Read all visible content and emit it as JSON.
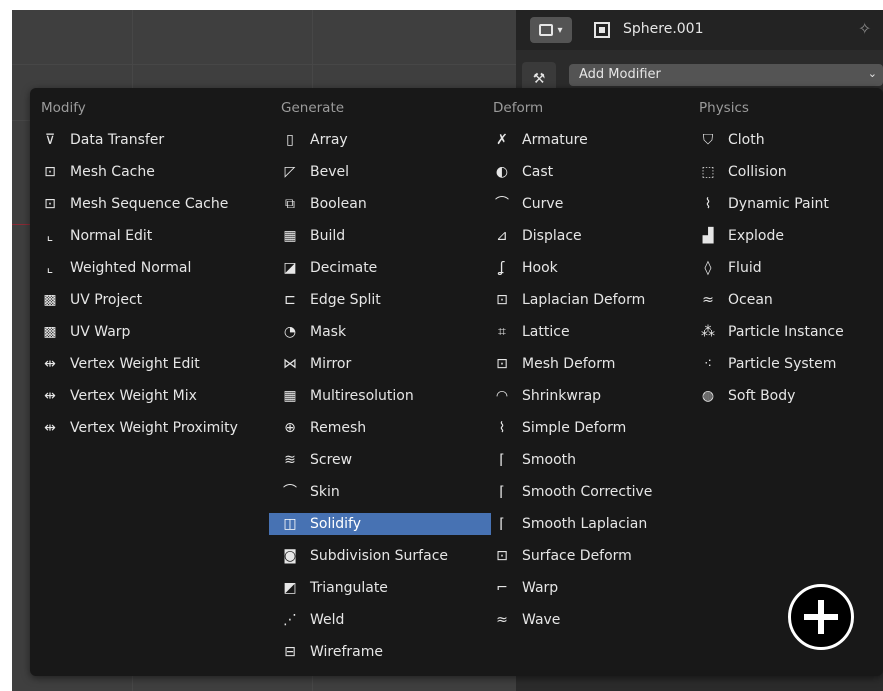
{
  "header": {
    "object_name": "Sphere.001",
    "add_modifier_label": "Add Modifier"
  },
  "menu": {
    "columns": [
      {
        "title": "Modify",
        "items": [
          {
            "label": "Data Transfer",
            "icon": "data-transfer-icon",
            "glyph": "⊽"
          },
          {
            "label": "Mesh Cache",
            "icon": "mesh-cache-icon",
            "glyph": "⊡"
          },
          {
            "label": "Mesh Sequence Cache",
            "icon": "mesh-sequence-cache-icon",
            "glyph": "⊡"
          },
          {
            "label": "Normal Edit",
            "icon": "normal-edit-icon",
            "glyph": "⌞"
          },
          {
            "label": "Weighted Normal",
            "icon": "weighted-normal-icon",
            "glyph": "⌞"
          },
          {
            "label": "UV Project",
            "icon": "uv-project-icon",
            "glyph": "▩"
          },
          {
            "label": "UV Warp",
            "icon": "uv-warp-icon",
            "glyph": "▩"
          },
          {
            "label": "Vertex Weight Edit",
            "icon": "vertex-weight-edit-icon",
            "glyph": "⇹"
          },
          {
            "label": "Vertex Weight Mix",
            "icon": "vertex-weight-mix-icon",
            "glyph": "⇹"
          },
          {
            "label": "Vertex Weight Proximity",
            "icon": "vertex-weight-proximity-icon",
            "glyph": "⇹"
          }
        ]
      },
      {
        "title": "Generate",
        "items": [
          {
            "label": "Array",
            "icon": "array-icon",
            "glyph": "▯"
          },
          {
            "label": "Bevel",
            "icon": "bevel-icon",
            "glyph": "◸"
          },
          {
            "label": "Boolean",
            "icon": "boolean-icon",
            "glyph": "⧉"
          },
          {
            "label": "Build",
            "icon": "build-icon",
            "glyph": "▦"
          },
          {
            "label": "Decimate",
            "icon": "decimate-icon",
            "glyph": "◪"
          },
          {
            "label": "Edge Split",
            "icon": "edge-split-icon",
            "glyph": "⊏"
          },
          {
            "label": "Mask",
            "icon": "mask-icon",
            "glyph": "◔"
          },
          {
            "label": "Mirror",
            "icon": "mirror-icon",
            "glyph": "⋈"
          },
          {
            "label": "Multiresolution",
            "icon": "multiresolution-icon",
            "glyph": "▦"
          },
          {
            "label": "Remesh",
            "icon": "remesh-icon",
            "glyph": "⊕"
          },
          {
            "label": "Screw",
            "icon": "screw-icon",
            "glyph": "≋"
          },
          {
            "label": "Skin",
            "icon": "skin-icon",
            "glyph": "⌒"
          },
          {
            "label": "Solidify",
            "icon": "solidify-icon",
            "glyph": "◫",
            "selected": true
          },
          {
            "label": "Subdivision Surface",
            "icon": "subdivision-surface-icon",
            "glyph": "◙"
          },
          {
            "label": "Triangulate",
            "icon": "triangulate-icon",
            "glyph": "◩"
          },
          {
            "label": "Weld",
            "icon": "weld-icon",
            "glyph": "⋰"
          },
          {
            "label": "Wireframe",
            "icon": "wireframe-icon",
            "glyph": "⊟"
          }
        ]
      },
      {
        "title": "Deform",
        "items": [
          {
            "label": "Armature",
            "icon": "armature-icon",
            "glyph": "✗"
          },
          {
            "label": "Cast",
            "icon": "cast-icon",
            "glyph": "◐"
          },
          {
            "label": "Curve",
            "icon": "curve-icon",
            "glyph": "⌒"
          },
          {
            "label": "Displace",
            "icon": "displace-icon",
            "glyph": "⊿"
          },
          {
            "label": "Hook",
            "icon": "hook-icon",
            "glyph": "ʆ"
          },
          {
            "label": "Laplacian Deform",
            "icon": "laplacian-deform-icon",
            "glyph": "⊡"
          },
          {
            "label": "Lattice",
            "icon": "lattice-icon",
            "glyph": "⌗"
          },
          {
            "label": "Mesh Deform",
            "icon": "mesh-deform-icon",
            "glyph": "⊡"
          },
          {
            "label": "Shrinkwrap",
            "icon": "shrinkwrap-icon",
            "glyph": "◠"
          },
          {
            "label": "Simple Deform",
            "icon": "simple-deform-icon",
            "glyph": "⌇"
          },
          {
            "label": "Smooth",
            "icon": "smooth-icon",
            "glyph": "⌈"
          },
          {
            "label": "Smooth Corrective",
            "icon": "smooth-corrective-icon",
            "glyph": "⌈"
          },
          {
            "label": "Smooth Laplacian",
            "icon": "smooth-laplacian-icon",
            "glyph": "⌈"
          },
          {
            "label": "Surface Deform",
            "icon": "surface-deform-icon",
            "glyph": "⊡"
          },
          {
            "label": "Warp",
            "icon": "warp-icon",
            "glyph": "⌐"
          },
          {
            "label": "Wave",
            "icon": "wave-icon",
            "glyph": "≈"
          }
        ]
      },
      {
        "title": "Physics",
        "items": [
          {
            "label": "Cloth",
            "icon": "cloth-icon",
            "glyph": "⛉"
          },
          {
            "label": "Collision",
            "icon": "collision-icon",
            "glyph": "⬚"
          },
          {
            "label": "Dynamic Paint",
            "icon": "dynamic-paint-icon",
            "glyph": "⌇"
          },
          {
            "label": "Explode",
            "icon": "explode-icon",
            "glyph": "▟"
          },
          {
            "label": "Fluid",
            "icon": "fluid-icon",
            "glyph": "◊"
          },
          {
            "label": "Ocean",
            "icon": "ocean-icon",
            "glyph": "≈"
          },
          {
            "label": "Particle Instance",
            "icon": "particle-instance-icon",
            "glyph": "⁂"
          },
          {
            "label": "Particle System",
            "icon": "particle-system-icon",
            "glyph": "⁖"
          },
          {
            "label": "Soft Body",
            "icon": "soft-body-icon",
            "glyph": "◍"
          }
        ]
      }
    ]
  },
  "colors": {
    "menu_bg": "#181818",
    "selection": "#4772b3",
    "header_text": "#9b9b9b",
    "item_text": "#e6e6e6"
  }
}
